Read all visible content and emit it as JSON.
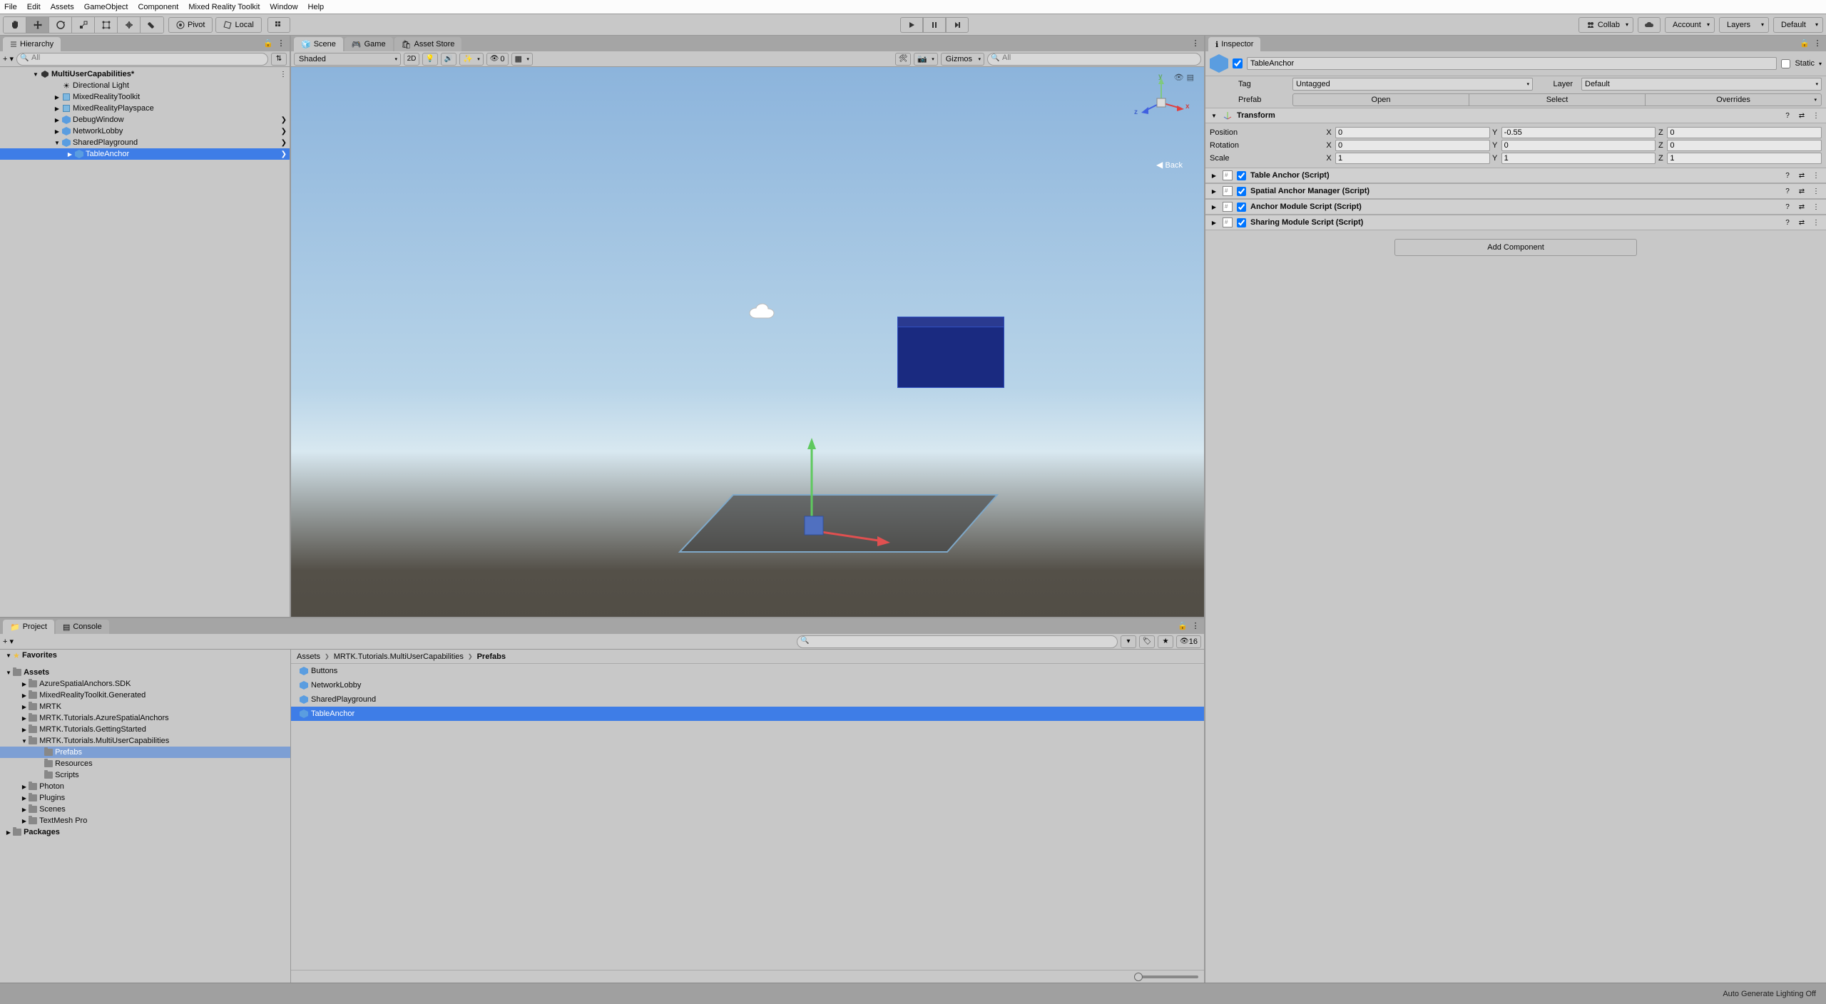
{
  "menu": [
    "File",
    "Edit",
    "Assets",
    "GameObject",
    "Component",
    "Mixed Reality Toolkit",
    "Window",
    "Help"
  ],
  "toolbar": {
    "pivot": "Pivot",
    "local": "Local",
    "collab": "Collab",
    "account": "Account",
    "layers": "Layers",
    "layout": "Default"
  },
  "hierarchy": {
    "tab": "Hierarchy",
    "search_placeholder": "All",
    "scene_name": "MultiUserCapabilities*",
    "items": [
      {
        "name": "Directional Light",
        "indent": 1,
        "icon": "light"
      },
      {
        "name": "MixedRealityToolkit",
        "indent": 1,
        "icon": "cube",
        "fold": true
      },
      {
        "name": "MixedRealityPlayspace",
        "indent": 1,
        "icon": "cube",
        "fold": true
      },
      {
        "name": "DebugWindow",
        "indent": 1,
        "icon": "prefab",
        "fold": true,
        "menu": true
      },
      {
        "name": "NetworkLobby",
        "indent": 1,
        "icon": "prefab",
        "fold": true,
        "menu": true
      },
      {
        "name": "SharedPlayground",
        "indent": 1,
        "icon": "prefab",
        "fold": true,
        "open": true,
        "menu": true
      },
      {
        "name": "TableAnchor",
        "indent": 2,
        "icon": "prefab",
        "fold": true,
        "selected": true,
        "menu": true
      }
    ]
  },
  "scene": {
    "tabs": [
      "Scene",
      "Game",
      "Asset Store"
    ],
    "shading": "Shaded",
    "mode2d": "2D",
    "layers_count": "0",
    "gizmos": "Gizmos",
    "search_placeholder": "All",
    "back": "Back",
    "axes": {
      "x": "x",
      "y": "y",
      "z": "z"
    }
  },
  "project": {
    "tabs": [
      "Project",
      "Console"
    ],
    "view_count": "16",
    "tree": {
      "favorites": "Favorites",
      "assets": "Assets",
      "folders": [
        {
          "name": "AzureSpatialAnchors.SDK",
          "indent": 1
        },
        {
          "name": "MixedRealityToolkit.Generated",
          "indent": 1
        },
        {
          "name": "MRTK",
          "indent": 1
        },
        {
          "name": "MRTK.Tutorials.AzureSpatialAnchors",
          "indent": 1
        },
        {
          "name": "MRTK.Tutorials.GettingStarted",
          "indent": 1
        },
        {
          "name": "MRTK.Tutorials.MultiUserCapabilities",
          "indent": 1,
          "open": true
        },
        {
          "name": "Prefabs",
          "indent": 2,
          "selected": true
        },
        {
          "name": "Resources",
          "indent": 2
        },
        {
          "name": "Scripts",
          "indent": 2
        },
        {
          "name": "Photon",
          "indent": 1
        },
        {
          "name": "Plugins",
          "indent": 1
        },
        {
          "name": "Scenes",
          "indent": 1
        },
        {
          "name": "TextMesh Pro",
          "indent": 1
        }
      ],
      "packages": "Packages"
    },
    "breadcrumb": [
      "Assets",
      "MRTK.Tutorials.MultiUserCapabilities",
      "Prefabs"
    ],
    "assets": [
      {
        "name": "Buttons"
      },
      {
        "name": "NetworkLobby"
      },
      {
        "name": "SharedPlayground"
      },
      {
        "name": "TableAnchor",
        "selected": true
      }
    ]
  },
  "inspector": {
    "tab": "Inspector",
    "name": "TableAnchor",
    "static": "Static",
    "tag_label": "Tag",
    "tag": "Untagged",
    "layer_label": "Layer",
    "layer": "Default",
    "prefab_label": "Prefab",
    "prefab_btns": [
      "Open",
      "Select",
      "Overrides"
    ],
    "transform": {
      "title": "Transform",
      "position": {
        "label": "Position",
        "x": "0",
        "y": "-0.55",
        "z": "0"
      },
      "rotation": {
        "label": "Rotation",
        "x": "0",
        "y": "0",
        "z": "0"
      },
      "scale": {
        "label": "Scale",
        "x": "1",
        "y": "1",
        "z": "1"
      }
    },
    "components": [
      "Table Anchor (Script)",
      "Spatial Anchor Manager (Script)",
      "Anchor Module Script (Script)",
      "Sharing Module Script (Script)"
    ],
    "add_component": "Add Component"
  },
  "statusbar": "Auto Generate Lighting Off"
}
